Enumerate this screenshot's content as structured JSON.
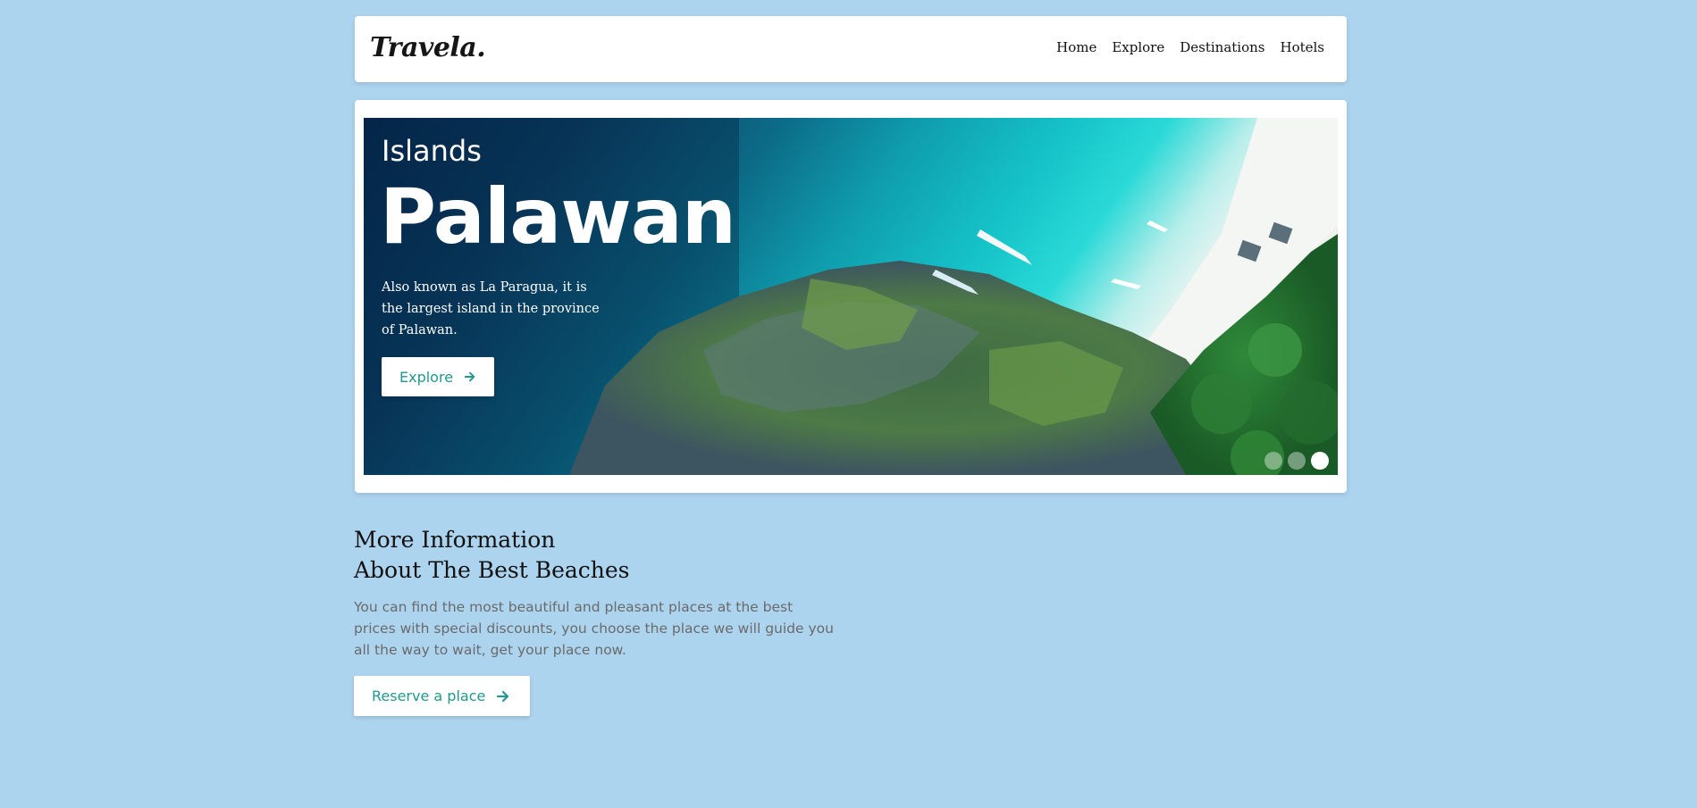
{
  "nav": {
    "logo": "Travela.",
    "links": [
      "Home",
      "Explore",
      "Destinations",
      "Hotels"
    ]
  },
  "hero": {
    "subtitle": "Islands",
    "title": "Palawan",
    "description": "Also known as La Paragua, it is the largest island in the province of Palawan.",
    "button_label": "Explore",
    "button_icon": "arrow-right-icon",
    "slides_total": 3,
    "active_slide": 3
  },
  "info": {
    "title_line1": "More Information",
    "title_line2": "About The Best Beaches",
    "text": "You can find the most beautiful and pleasant places at the best prices with special discounts, you choose the place we will guide you all the way to wait, get your place now.",
    "button_label": "Reserve a place",
    "button_icon": "arrow-right-icon"
  },
  "colors": {
    "background": "#add4ef",
    "accent": "#23988f",
    "card": "#ffffff"
  }
}
